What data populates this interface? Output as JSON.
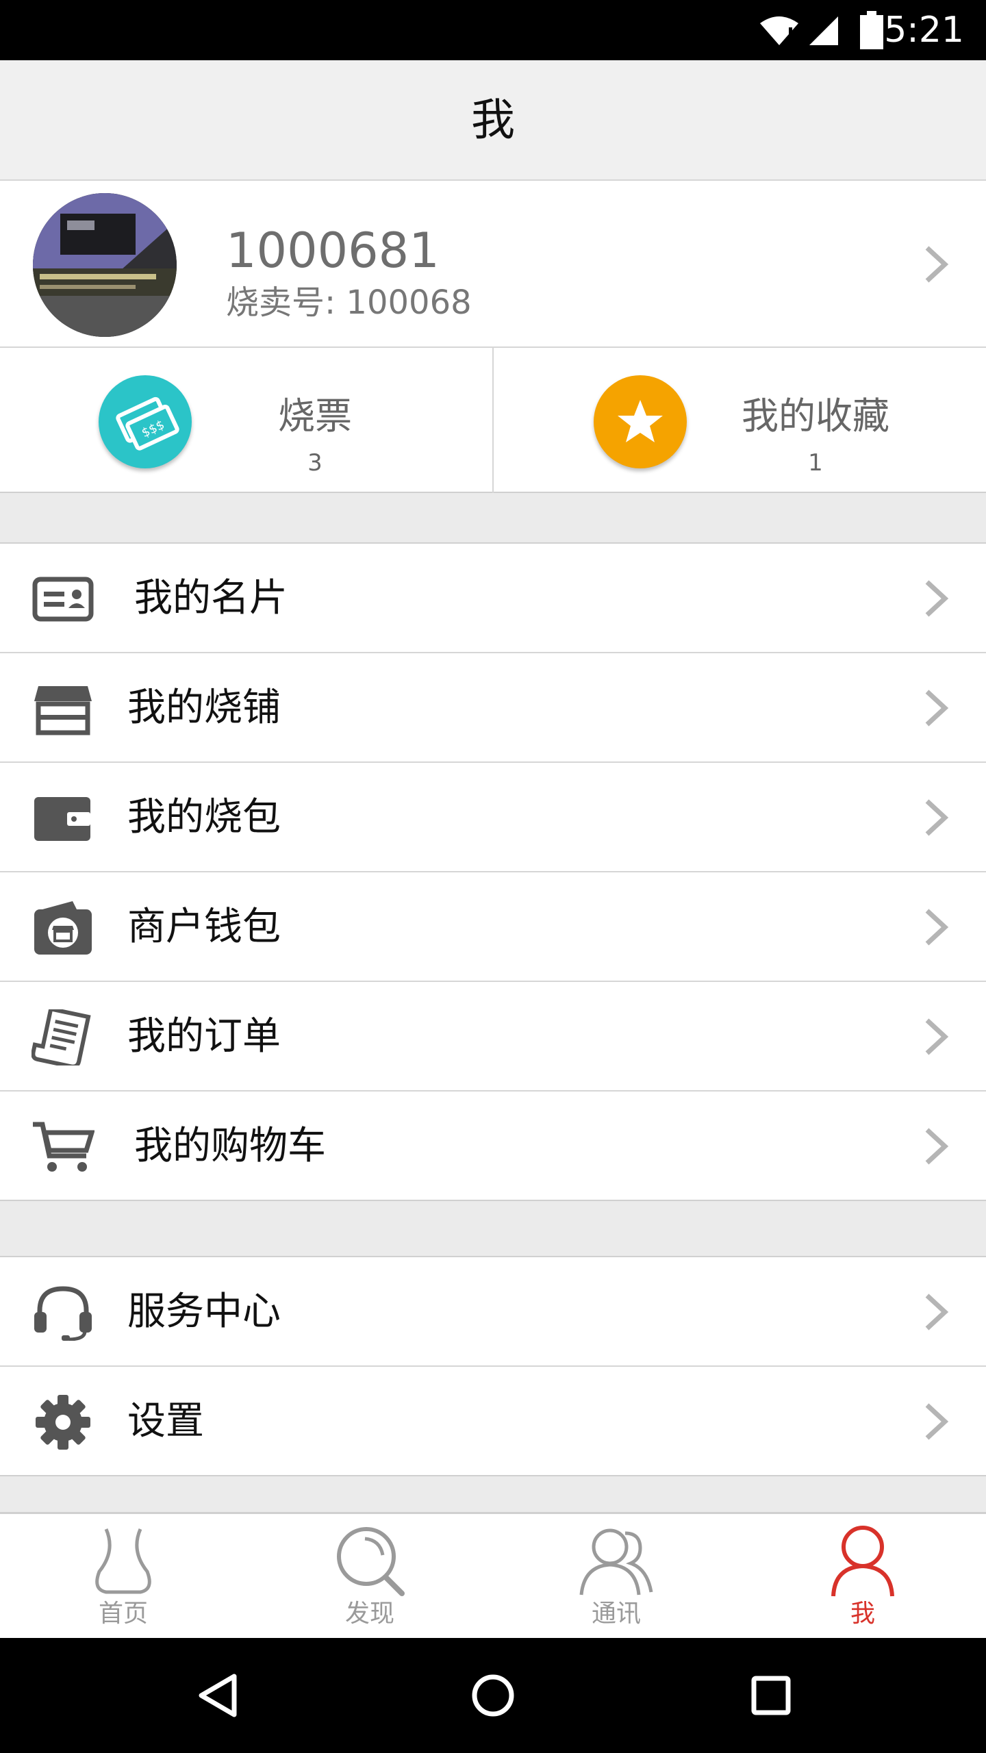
{
  "status_bar": {
    "time": "5:21"
  },
  "header": {
    "title": "我"
  },
  "profile": {
    "username": "1000681",
    "id_label": "烧卖号: 100068"
  },
  "stats": [
    {
      "label": "烧票",
      "count": "3",
      "color": "#2bc4c8"
    },
    {
      "label": "我的收藏",
      "count": "1",
      "color": "#f5a300"
    }
  ],
  "menu": {
    "group1": [
      {
        "label": "我的名片",
        "icon": "business-card-icon"
      },
      {
        "label": "我的烧铺",
        "icon": "shop-icon"
      },
      {
        "label": "我的烧包",
        "icon": "wallet-icon"
      },
      {
        "label": "商户钱包",
        "icon": "merchant-wallet-icon"
      },
      {
        "label": "我的订单",
        "icon": "order-receipt-icon"
      },
      {
        "label": "我的购物车",
        "icon": "shopping-cart-icon"
      }
    ],
    "group2": [
      {
        "label": "服务中心",
        "icon": "headset-icon"
      },
      {
        "label": "设置",
        "icon": "gear-icon"
      }
    ]
  },
  "tabs": [
    {
      "label": "首页",
      "icon": "home-vase-icon",
      "active": false
    },
    {
      "label": "发现",
      "icon": "search-icon",
      "active": false
    },
    {
      "label": "通讯",
      "icon": "contacts-icon",
      "active": false
    },
    {
      "label": "我",
      "icon": "profile-icon",
      "active": true
    }
  ],
  "colors": {
    "accent": "#d8322a",
    "inactive": "#9a9a9a",
    "icon_gray": "#555555"
  }
}
